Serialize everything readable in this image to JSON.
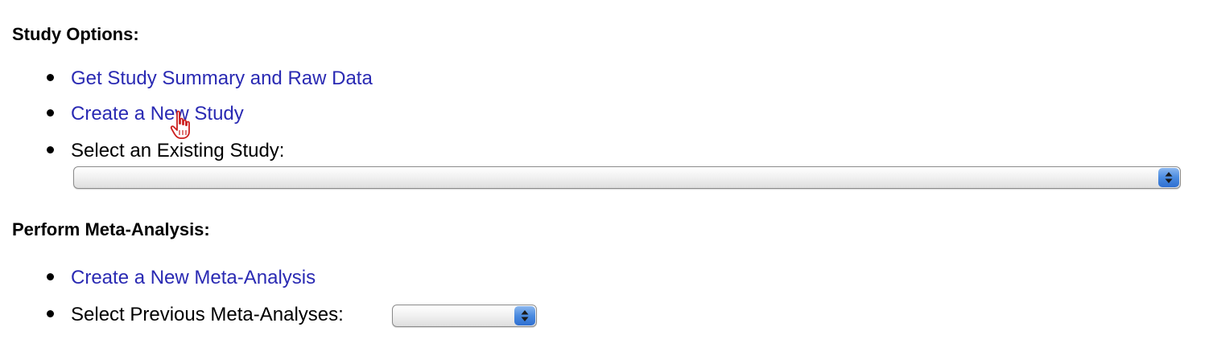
{
  "study_options": {
    "title": "Study Options:",
    "items": [
      {
        "label": "Get Study Summary and Raw Data"
      },
      {
        "label": "Create a New Study"
      },
      {
        "label": "Select an Existing Study:"
      }
    ],
    "existing_study_select": {
      "value": ""
    }
  },
  "meta_analysis": {
    "title": "Perform Meta-Analysis:",
    "items": [
      {
        "label": "Create a New Meta-Analysis"
      },
      {
        "label": "Select Previous Meta-Analyses:"
      }
    ],
    "previous_select": {
      "value": ""
    }
  },
  "cursor": {
    "icon": "hand-pointer-icon"
  },
  "colors": {
    "link": "#2a2ab3",
    "select_arrow": "#3a7ad8"
  }
}
